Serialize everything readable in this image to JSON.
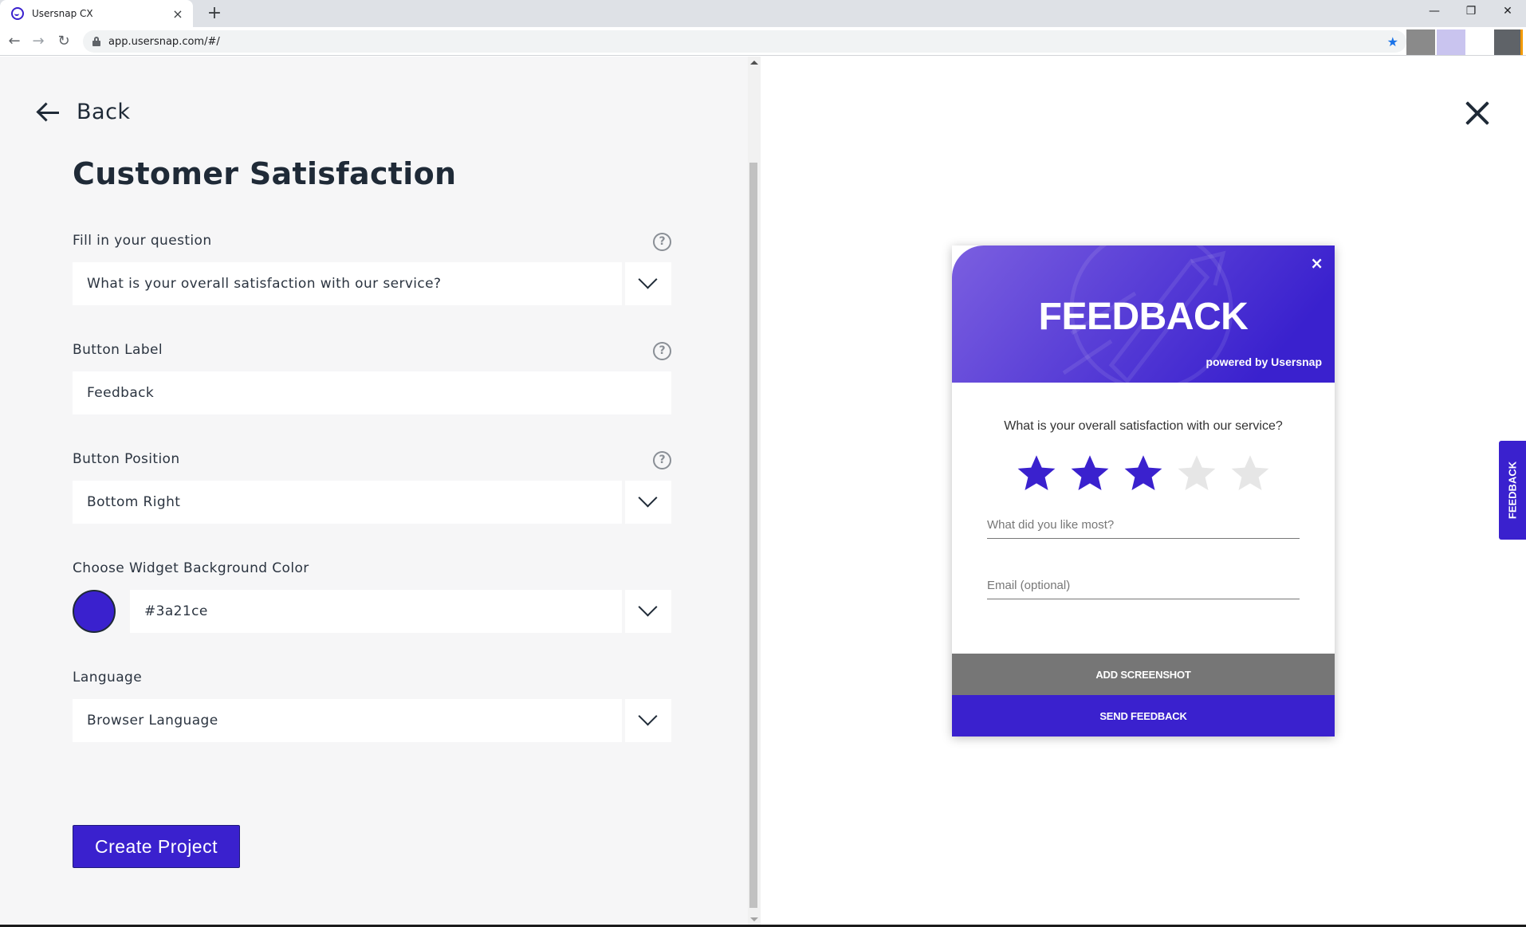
{
  "browser": {
    "tab_title": "Usersnap CX",
    "tab_close": "×",
    "new_tab": "+",
    "url": "app.usersnap.com/#/",
    "window_controls": {
      "minimize": "—",
      "restore": "❐",
      "close": "✕"
    },
    "nav": {
      "back": "←",
      "forward": "→",
      "reload": "↻"
    },
    "bookmark_star": "★"
  },
  "form": {
    "back_label": "Back",
    "title": "Customer Satisfaction",
    "question": {
      "label": "Fill in your question",
      "value": "What is your overall satisfaction with our service?",
      "help": "?"
    },
    "button_label": {
      "label": "Button Label",
      "value": "Feedback",
      "help": "?"
    },
    "button_position": {
      "label": "Button Position",
      "value": "Bottom Right",
      "help": "?"
    },
    "background_color": {
      "label": "Choose Widget Background Color",
      "value": "#3a21ce"
    },
    "language": {
      "label": "Language",
      "value": "Browser Language"
    },
    "create_button": "Create Project"
  },
  "preview": {
    "close": "×",
    "widget": {
      "title": "FEEDBACK",
      "powered_by": "powered by Usersnap",
      "question": "What is your overall satisfaction with our service?",
      "rating": 3,
      "max_rating": 5,
      "liked_placeholder": "What did you like most?",
      "email_placeholder": "Email (optional)",
      "screenshot_button": "ADD SCREENSHOT",
      "send_button": "SEND FEEDBACK"
    },
    "side_tab_label": "FEEDBACK"
  },
  "colors": {
    "accent": "#3a21ce",
    "header_gradient_start": "#7b5fe0",
    "header_gradient_end": "#3a21ce",
    "star_empty": "#e6e6e6",
    "screenshot_button": "#767676"
  }
}
